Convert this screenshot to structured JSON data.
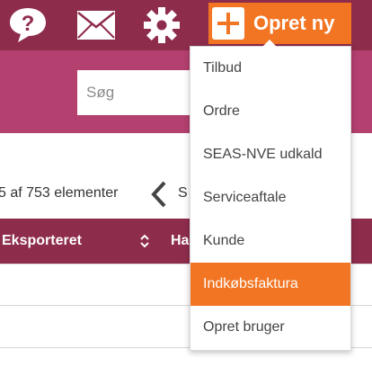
{
  "header": {
    "icons": [
      "help-icon",
      "mail-icon",
      "gear-icon",
      "plus-icon"
    ],
    "create_button_label": "Opret ny"
  },
  "search": {
    "placeholder": "Søg",
    "value": ""
  },
  "pager": {
    "count_text": "5 af 753 elementer",
    "next_partial": "S"
  },
  "table": {
    "columns": [
      "Eksporteret",
      "Ha"
    ]
  },
  "create_menu": {
    "items": [
      {
        "label": "Tilbud"
      },
      {
        "label": "Ordre"
      },
      {
        "label": "SEAS-NVE udkald"
      },
      {
        "label": "Serviceaftale"
      },
      {
        "label": "Kunde"
      },
      {
        "label": "Indkøbsfaktura"
      },
      {
        "label": "Opret bruger"
      }
    ],
    "highlighted_index": 5
  },
  "colors": {
    "topbar": "#8e2c4c",
    "secondbar": "#b3406f",
    "accent": "#f27523"
  }
}
